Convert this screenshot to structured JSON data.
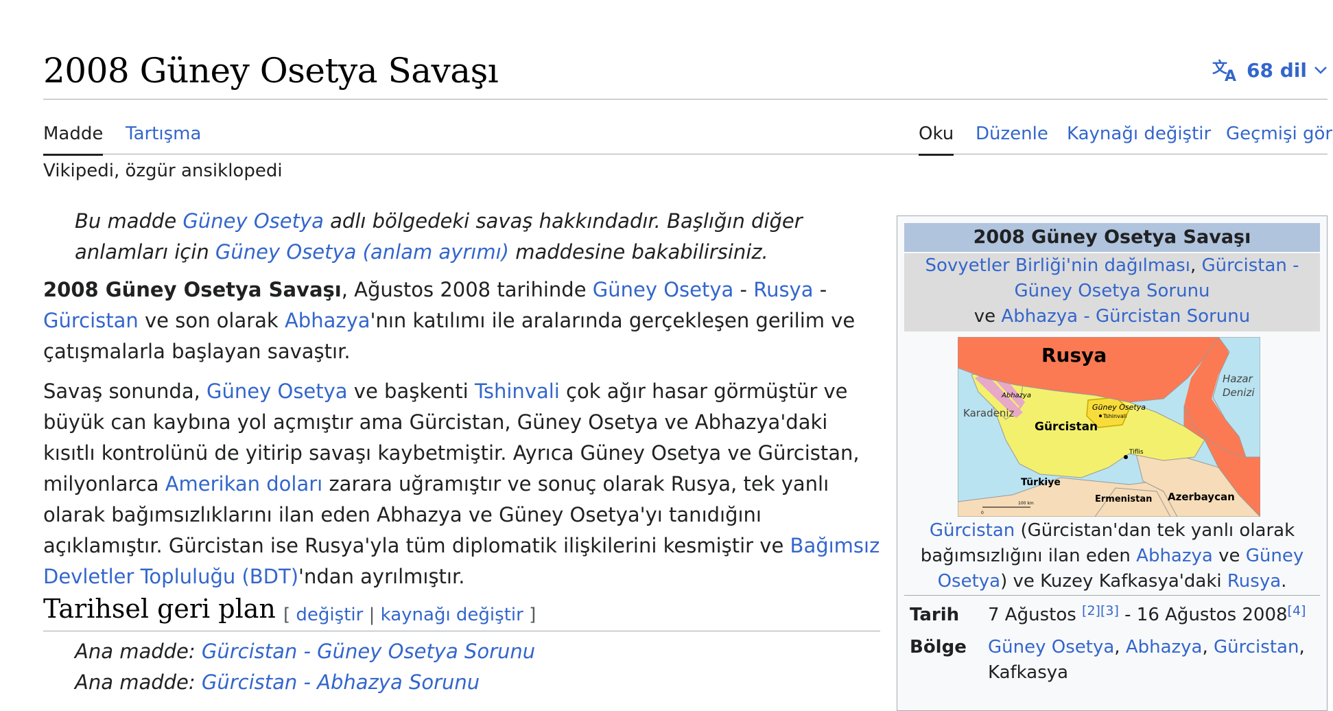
{
  "header": {
    "title": "2008 Güney Osetya Savaşı",
    "languages_label": "68 dil",
    "icon": "translate-icon"
  },
  "tabs": {
    "left": [
      "Madde",
      "Tartışma"
    ],
    "right": [
      "Oku",
      "Düzenle",
      "Kaynağı değiştir",
      "Geçmişi gör"
    ]
  },
  "tagline": "Vikipedi, özgür ansiklopedi",
  "hatnote": {
    "t1": "Bu madde ",
    "l1": "Güney Osetya",
    "t2": " adlı bölgedeki savaş hakkındadır. Başlığın diğer anlamları için ",
    "l2": "Güney Osetya (anlam ayrımı)",
    "t3": " maddesine bakabilirsiniz."
  },
  "intro": {
    "bold": "2008 Güney Osetya Savaşı",
    "t1": ", Ağustos 2008 tarihinde ",
    "l1": "Güney Osetya",
    "sep1": " - ",
    "l2": "Rusya",
    "sep2": " - ",
    "l3": "Gürcistan",
    "t2": " ve son olarak ",
    "l4": "Abhazya",
    "t3": "'nın katılımı ile aralarında gerçekleşen gerilim ve çatışmalarla başlayan savaştır."
  },
  "paragraph2": {
    "t1": "Savaş sonunda, ",
    "l1": "Güney Osetya",
    "t2": " ve başkenti ",
    "l2": "Tshinvali",
    "t3": " çok ağır hasar görmüştür ve büyük can kaybına yol açmıştır ama Gürcistan, Güney Osetya ve Abhazya'daki kısıtlı kontrolünü de yitirip savaşı kaybetmiştir. Ayrıca Güney Osetya ve Gürcistan, milyonlarca ",
    "l3": "Amerikan doları",
    "t4": " zarara uğramıştır ve sonuç olarak Rusya, tek yanlı olarak bağımsızlıklarını ilan eden Abhazya ve Güney Osetya'yı tanıdığını açıklamıştır. Gürcistan ise Rusya'yla tüm diplomatik ilişkilerini kesmiştir ve ",
    "l4": "Bağımsız Devletler Topluluğu (BDT)",
    "t5": "'ndan ayrılmıştır."
  },
  "section": {
    "title": "Tarihsel geri plan",
    "edit_open": "[ ",
    "edit_label": "değiştir",
    "edit_sep": " | ",
    "edit_source_label": "kaynağı değiştir",
    "edit_close": " ]",
    "main_articles": [
      {
        "prefix": "Ana madde: ",
        "link": "Gürcistan - Güney Osetya Sorunu"
      },
      {
        "prefix": "Ana madde: ",
        "link": "Gürcistan - Abhazya Sorunu"
      }
    ]
  },
  "infobox": {
    "title": "2008 Güney Osetya Savaşı",
    "sub_l1": "Sovyetler Birliği'nin dağılması",
    "sub_sep": ", ",
    "sub_l2": "Gürcistan - Güney Osetya Sorunu",
    "sub_t1": "ve ",
    "sub_l3": "Abhazya - Gürcistan Sorunu",
    "map": {
      "rusya": "Rusya",
      "hazar": "Hazar",
      "denizi": "Denizi",
      "abhazya": "Abhazya",
      "guney_osetya": "Güney Osetya",
      "tshinvali": "Tshinvali",
      "karadeniz": "Karadeniz",
      "gurcistan": "Gürcistan",
      "tiflis": "Tiflis",
      "turkiye": "Türkiye",
      "ermenistan": "Ermenistan",
      "azerbaycan": "Azerbaycan",
      "scale_label": "100 km",
      "scale_zero": "0"
    },
    "caption": {
      "l1": "Gürcistan",
      "t1": " (Gürcistan'dan tek yanlı olarak bağımsızlığını ilan eden ",
      "l2": "Abhazya",
      "t2": " ve ",
      "l3": "Güney Osetya",
      "t3": ") ve Kuzey Kafkasya'daki ",
      "l4": "Rusya",
      "t4": "."
    },
    "rows": {
      "date_label": "Tarih",
      "date_t1": "7 Ağustos ",
      "date_ref1": "[2]",
      "date_ref2": "[3]",
      "date_t2": " - 16 Ağustos 2008",
      "date_ref3": "[4]",
      "region_label": "Bölge",
      "region_l1": "Güney Osetya",
      "region_sep1": ", ",
      "region_l2": "Abhazya",
      "region_sep2": ", ",
      "region_l3": "Gürcistan",
      "region_sep3": ",",
      "region_t1": "Kafkasya"
    }
  },
  "colors": {
    "link": "#3366cc",
    "text": "#202122",
    "infobox_title_bg": "#b0c4de",
    "infobox_sub_bg": "#dcdcdc",
    "map_russia": "#fb7a53",
    "map_georgia": "#f3f06e",
    "map_sea": "#b9e3f0",
    "map_neighbors": "#f6dcb8"
  }
}
